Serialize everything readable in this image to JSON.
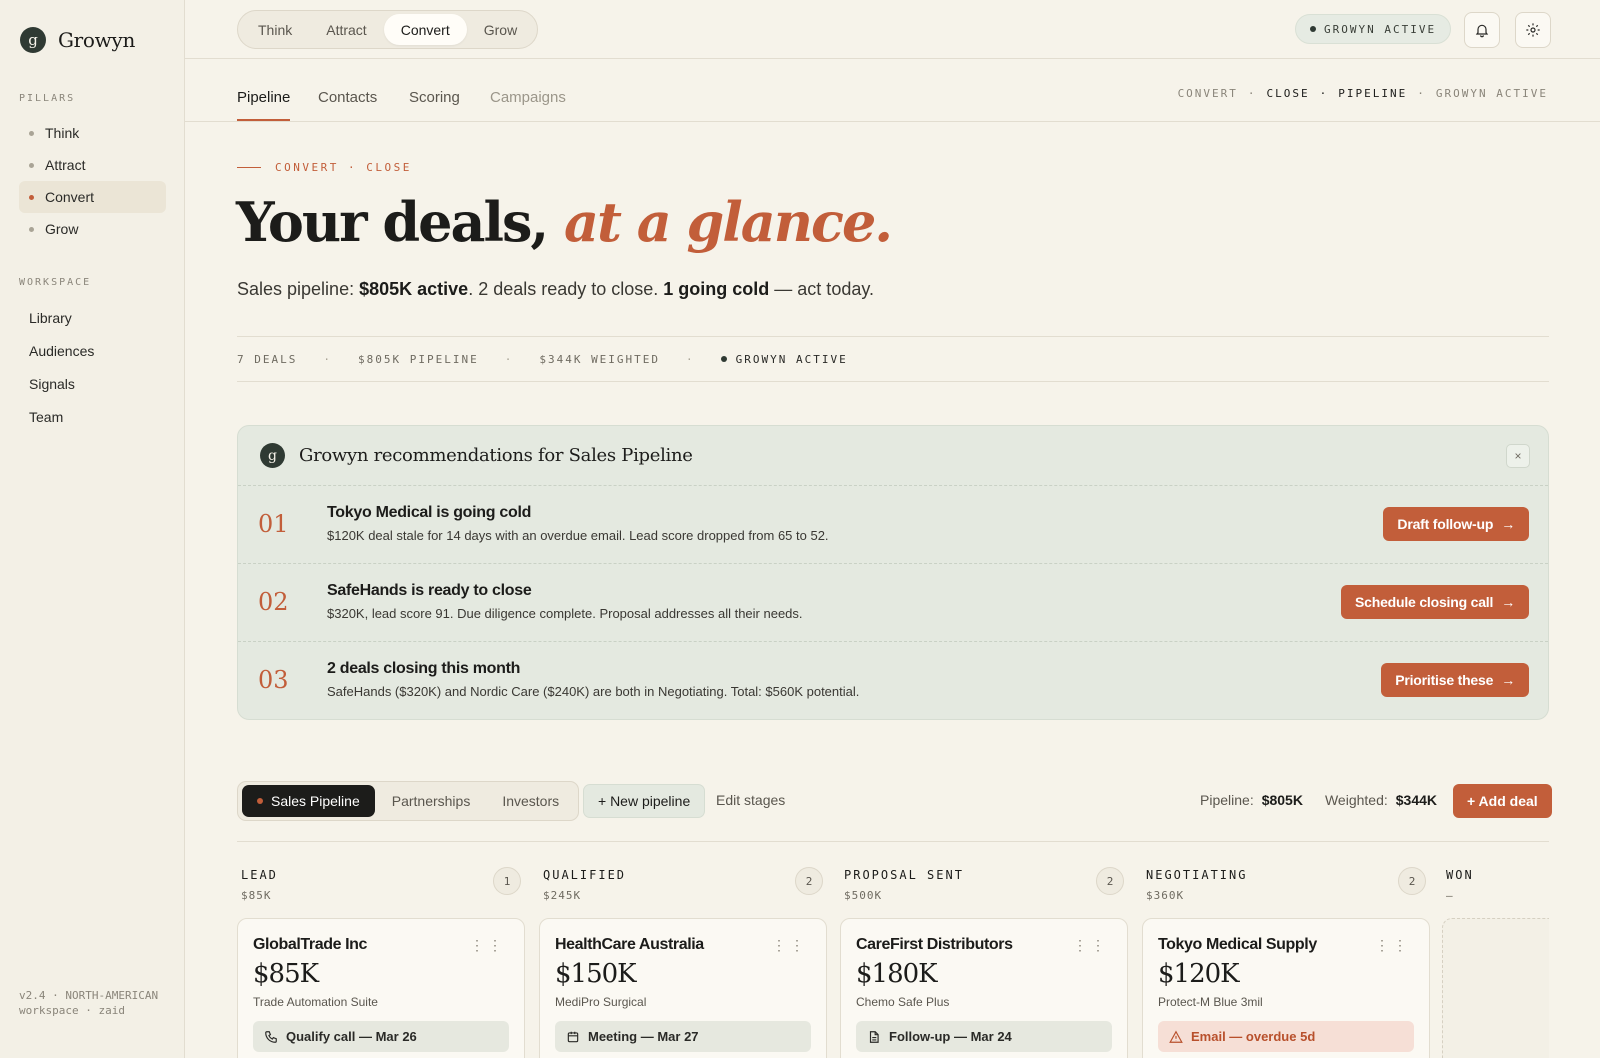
{
  "brand": {
    "logo_letter": "g",
    "name": "Growyn"
  },
  "sidebar": {
    "pillars_heading": "PILLARS",
    "pillars": [
      {
        "label": "Think"
      },
      {
        "label": "Attract"
      },
      {
        "label": "Convert",
        "active": true
      },
      {
        "label": "Grow"
      }
    ],
    "workspace_heading": "WORKSPACE",
    "workspace": [
      {
        "label": "Library"
      },
      {
        "label": "Audiences"
      },
      {
        "label": "Signals"
      },
      {
        "label": "Team"
      }
    ],
    "footer": "v2.4 · NORTH-AMERICAN workspace · zaid"
  },
  "topbar": {
    "pillar_tabs": [
      "Think",
      "Attract",
      "Convert",
      "Grow"
    ],
    "active_tab": "Convert",
    "status": "GROWYN ACTIVE"
  },
  "subnav": {
    "tabs": [
      "Pipeline",
      "Contacts",
      "Scoring",
      "Campaigns"
    ],
    "active": "Pipeline",
    "crumbs": [
      "CONVERT",
      "·",
      "CLOSE",
      "·",
      "PIPELINE",
      "·",
      "GROWYN ACTIVE"
    ]
  },
  "hero": {
    "eyebrow": "CONVERT · CLOSE",
    "title_plain": "Your deals,",
    "title_accent": "at a glance.",
    "sub_prefix": "Sales pipeline: ",
    "sub_bold1": "$805K active",
    "sub_mid": ". 2 deals ready to close. ",
    "sub_bold2": "1 going cold",
    "sub_suffix": " — act today."
  },
  "stats": {
    "deals": "7 DEALS",
    "pipeline": "$805K PIPELINE",
    "weighted": "$344K WEIGHTED",
    "status": "GROWYN ACTIVE",
    "separator": "·"
  },
  "recommendations": {
    "title": "Growyn recommendations for Sales Pipeline",
    "close": "×",
    "items": [
      {
        "num": "01",
        "title": "Tokyo Medical is going cold",
        "body": "$120K deal stale for 14 days with an overdue email. Lead score dropped from 65 to 52.",
        "action": "Draft follow-up"
      },
      {
        "num": "02",
        "title": "SafeHands is ready to close",
        "body": "$320K, lead score 91. Due diligence complete. Proposal addresses all their needs.",
        "action": "Schedule closing call"
      },
      {
        "num": "03",
        "title": "2 deals closing this month",
        "body": "SafeHands ($320K) and Nordic Care ($240K) are both in Negotiating. Total: $560K potential.",
        "action": "Prioritise these"
      }
    ]
  },
  "pipelines": {
    "tabs": [
      "Sales Pipeline",
      "Partnerships",
      "Investors"
    ],
    "active": "Sales Pipeline",
    "new_pipeline": "+ New pipeline",
    "edit_stages": "Edit stages",
    "pipeline_label": "Pipeline:",
    "pipeline_value": "$805K",
    "weighted_label": "Weighted:",
    "weighted_value": "$344K",
    "add_deal": "+ Add deal"
  },
  "columns": [
    {
      "name": "LEAD",
      "value": "$85K",
      "count": "1",
      "deal": {
        "company": "GlobalTrade Inc",
        "menu": "⋮⋮",
        "amount": "$85K",
        "product": "Trade Automation Suite",
        "action": "Qualify call — Mar 26",
        "icon": "phone-icon",
        "alert": false
      }
    },
    {
      "name": "QUALIFIED",
      "value": "$245K",
      "count": "2",
      "deal": {
        "company": "HealthCare Australia",
        "menu": "⋮⋮",
        "amount": "$150K",
        "product": "MediPro Surgical",
        "action": "Meeting — Mar 27",
        "icon": "calendar-icon",
        "alert": false
      }
    },
    {
      "name": "PROPOSAL SENT",
      "value": "$500K",
      "count": "2",
      "deal": {
        "company": "CareFirst Distributors",
        "menu": "⋮⋮",
        "amount": "$180K",
        "product": "Chemo Safe Plus",
        "action": "Follow-up — Mar 24",
        "icon": "document-icon",
        "alert": false
      }
    },
    {
      "name": "NEGOTIATING",
      "value": "$360K",
      "count": "2",
      "deal": {
        "company": "Tokyo Medical Supply",
        "menu": "⋮⋮",
        "amount": "$120K",
        "product": "Protect-M Blue 3mil",
        "action": "Email — overdue 5d",
        "icon": "warning-icon",
        "alert": true
      }
    },
    {
      "name": "WON",
      "value": "—"
    }
  ],
  "colors": {
    "accent": "#c25e3a",
    "dark": "#1c1c1a",
    "background": "#f6f3ea",
    "sage": "#e4e9e0"
  }
}
